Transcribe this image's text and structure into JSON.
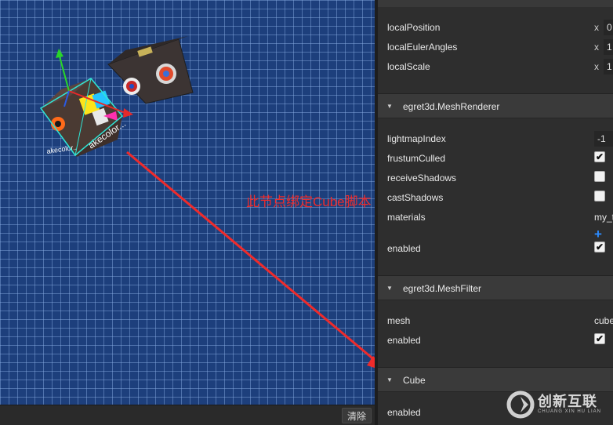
{
  "viewport": {
    "cube_label_1": "akecolor..",
    "cube_label_2": "akecolor..."
  },
  "console": {
    "clear_label": "清除"
  },
  "transform": {
    "rows": [
      {
        "label": "localPosition",
        "axis": "x",
        "value": "0"
      },
      {
        "label": "localEulerAngles",
        "axis": "x",
        "value": "1"
      },
      {
        "label": "localScale",
        "axis": "x",
        "value": "1"
      }
    ]
  },
  "mesh_renderer": {
    "title": "egret3d.MeshRenderer",
    "lightmapIndex_label": "lightmapIndex",
    "lightmapIndex_value": "-1",
    "frustumCulled_label": "frustumCulled",
    "frustumCulled_checked": true,
    "receiveShadows_label": "receiveShadows",
    "receiveShadows_checked": false,
    "castShadows_label": "castShadows",
    "castShadows_checked": false,
    "materials_label": "materials",
    "materials_value": "my_t",
    "add_icon": "plus-icon",
    "enabled_label": "enabled",
    "enabled_checked": true
  },
  "mesh_filter": {
    "title": "egret3d.MeshFilter",
    "mesh_label": "mesh",
    "mesh_value": "cube",
    "enabled_label": "enabled",
    "enabled_checked": true
  },
  "cube_component": {
    "title": "Cube",
    "enabled_label": "enabled"
  },
  "annotation": {
    "text": "此节点绑定Cube脚本",
    "color": "#ef2b2b"
  },
  "watermark": {
    "text": "创新互联",
    "sub": "CHUANG XIN HU LIAN"
  },
  "check_mark": "✔",
  "expand_triangle": "▼"
}
